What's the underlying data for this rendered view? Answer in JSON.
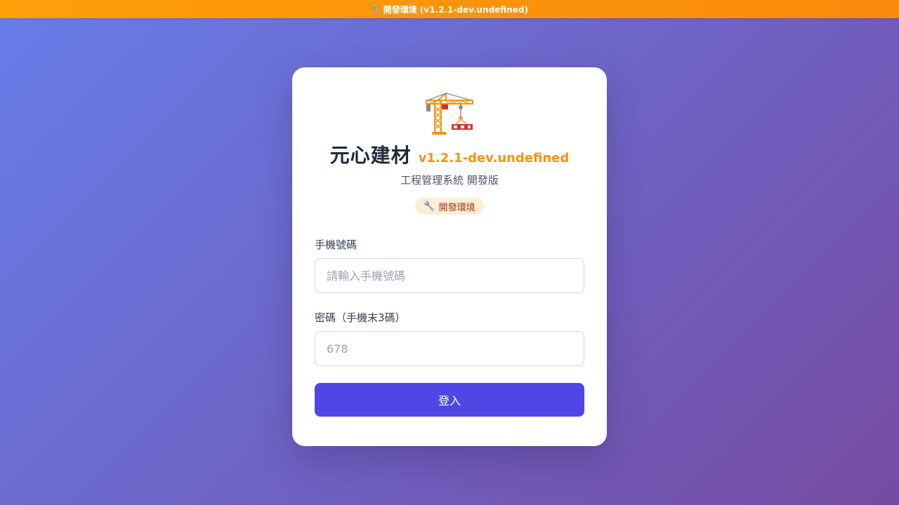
{
  "banner": {
    "icon": "wrench-icon",
    "text": "開發環境 (v1.2.1-dev.undefined)"
  },
  "brand": {
    "logo_icon": "construction-crane-icon",
    "title": "元心建材",
    "version": "v1.2.1-dev.undefined",
    "subtitle": "工程管理系統 開發版"
  },
  "env_badge": {
    "icon": "wrench-icon",
    "text": "開發環境"
  },
  "form": {
    "phone_label": "手機號碼",
    "phone_placeholder": "請輸入手機號碼",
    "phone_value": "",
    "password_label": "密碼（手機末3碼）",
    "password_placeholder": "678",
    "password_value": "",
    "submit_label": "登入"
  },
  "colors": {
    "banner": "#f98a0c",
    "version_text": "#f7930e",
    "primary_button": "#4f46e5",
    "badge_bg": "#ffedd5",
    "background_start": "#667eea",
    "background_end": "#764ba2"
  }
}
